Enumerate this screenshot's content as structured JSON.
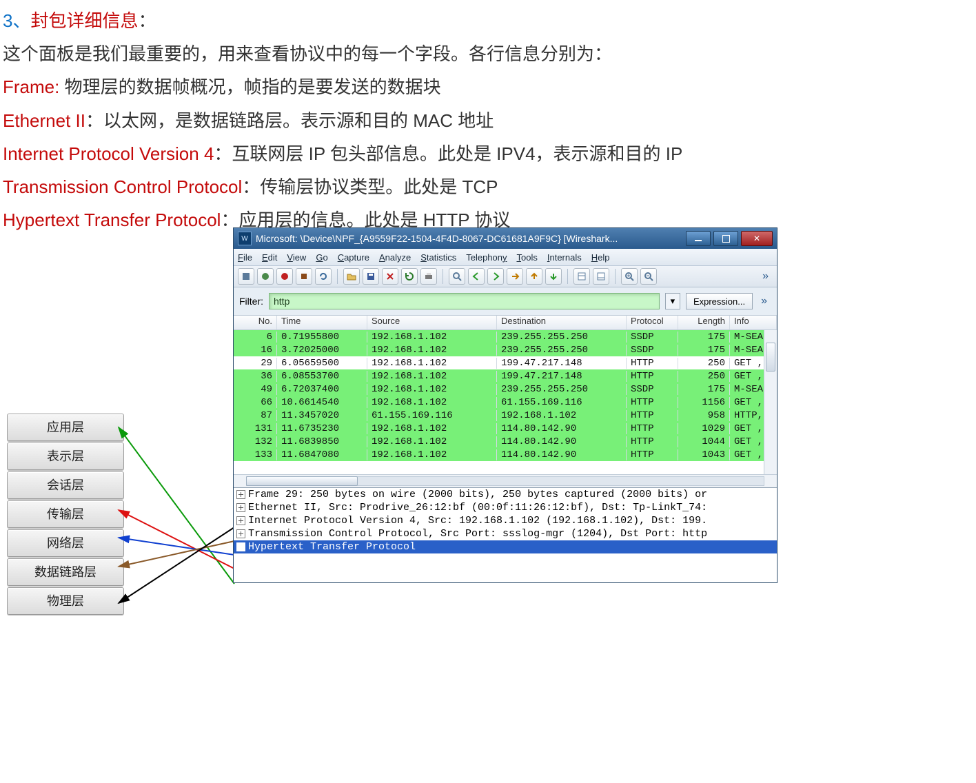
{
  "doc": {
    "heading_num": "3、",
    "heading_title": "封包详细信息",
    "heading_colon": "：",
    "p1": "这个面板是我们最重要的，用来查看协议中的每一个字段。各行信息分别为：",
    "frame_lbl": "Frame:",
    "frame_txt": "   物理层的数据帧概况，帧指的是要发送的数据块",
    "eth_lbl": "Ethernet II",
    "eth_txt": "：以太网，是数据链路层。表示源和目的 MAC 地址",
    "ip_lbl": "Internet Protocol Version 4",
    "ip_txt": "：互联网层 IP 包头部信息。此处是 IPV4，表示源和目的 IP",
    "tcp_lbl": "Transmission Control Protocol",
    "tcp_txt": "：传输层协议类型。此处是 TCP",
    "http_lbl": "Hypertext Transfer Protocol",
    "http_txt": "：应用层的信息。此处是 HTTP 协议"
  },
  "osi": {
    "layers": [
      "应用层",
      "表示层",
      "会话层",
      "传输层",
      "网络层",
      "数据链路层",
      "物理层"
    ]
  },
  "ws": {
    "title": "Microsoft: \\Device\\NPF_{A9559F22-1504-4F4D-8067-DC61681A9F9C}   [Wireshark...",
    "menus": {
      "file": "File",
      "edit": "Edit",
      "view": "View",
      "go": "Go",
      "capture": "Capture",
      "analyze": "Analyze",
      "stats": "Statistics",
      "telephony": "Telephony",
      "tools": "Tools",
      "internals": "Internals",
      "help": "Help"
    },
    "filter_label": "Filter:",
    "filter_value": "http",
    "expression_btn": "Expression...",
    "headers": {
      "no": "No.",
      "time": "Time",
      "src": "Source",
      "dst": "Destination",
      "proto": "Protocol",
      "len": "Length",
      "info": "Info"
    },
    "rows": [
      {
        "no": "6",
        "time": "0.71955800",
        "src": "192.168.1.102",
        "dst": "239.255.255.250",
        "proto": "SSDP",
        "len": "175",
        "info": "M-SEA",
        "cls": "green"
      },
      {
        "no": "16",
        "time": "3.72025000",
        "src": "192.168.1.102",
        "dst": "239.255.255.250",
        "proto": "SSDP",
        "len": "175",
        "info": "M-SEA",
        "cls": "green"
      },
      {
        "no": "29",
        "time": "6.05659500",
        "src": "192.168.1.102",
        "dst": "199.47.217.148",
        "proto": "HTTP",
        "len": "250",
        "info": "GET ,",
        "cls": "white"
      },
      {
        "no": "36",
        "time": "6.08553700",
        "src": "192.168.1.102",
        "dst": "199.47.217.148",
        "proto": "HTTP",
        "len": "250",
        "info": "GET ,",
        "cls": "green"
      },
      {
        "no": "49",
        "time": "6.72037400",
        "src": "192.168.1.102",
        "dst": "239.255.255.250",
        "proto": "SSDP",
        "len": "175",
        "info": "M-SEA",
        "cls": "green"
      },
      {
        "no": "66",
        "time": "10.6614540",
        "src": "192.168.1.102",
        "dst": "61.155.169.116",
        "proto": "HTTP",
        "len": "1156",
        "info": "GET ,",
        "cls": "green"
      },
      {
        "no": "87",
        "time": "11.3457020",
        "src": "61.155.169.116",
        "dst": "192.168.1.102",
        "proto": "HTTP",
        "len": "958",
        "info": "HTTP,",
        "cls": "green"
      },
      {
        "no": "131",
        "time": "11.6735230",
        "src": "192.168.1.102",
        "dst": "114.80.142.90",
        "proto": "HTTP",
        "len": "1029",
        "info": "GET ,",
        "cls": "green"
      },
      {
        "no": "132",
        "time": "11.6839850",
        "src": "192.168.1.102",
        "dst": "114.80.142.90",
        "proto": "HTTP",
        "len": "1044",
        "info": "GET ,",
        "cls": "green"
      },
      {
        "no": "133",
        "time": "11.6847080",
        "src": "192.168.1.102",
        "dst": "114.80.142.90",
        "proto": "HTTP",
        "len": "1043",
        "info": "GET ,",
        "cls": "green"
      }
    ],
    "details": {
      "frame": "Frame 29: 250 bytes on wire (2000 bits), 250 bytes captured (2000 bits) or",
      "eth": "Ethernet II, Src: Prodrive_26:12:bf (00:0f:11:26:12:bf), Dst: Tp-LinkT_74:",
      "ip": "Internet Protocol Version 4, Src: 192.168.1.102 (192.168.1.102), Dst: 199.",
      "tcp": "Transmission Control Protocol, Src Port: ssslog-mgr (1204), Dst Port: http",
      "http": "Hypertext Transfer Protocol"
    }
  }
}
